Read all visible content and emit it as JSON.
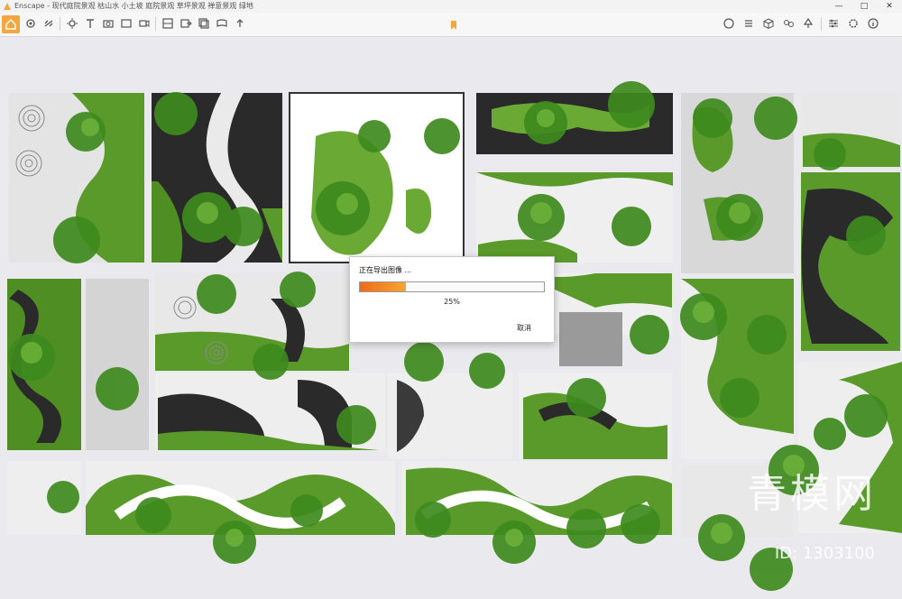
{
  "window": {
    "title": "Enscape - 现代庭院景观 枯山水 小土坡 庭院景观 草坪景观 禅意景观 绿地",
    "controls": [
      "—",
      "□",
      "✕"
    ]
  },
  "toolbar": {
    "icons": [
      "home-icon",
      "settings-icon",
      "link-icon",
      "sun-icon",
      "text-icon",
      "camera-icon",
      "frame-icon",
      "video-icon",
      "view-icon",
      "export-icon",
      "export-batch-icon",
      "panorama-icon",
      "upload-icon",
      "bookmark-icon",
      "material-icon",
      "list-icon",
      "cube-icon",
      "asset-icon",
      "tree-icon",
      "settings2-icon",
      "info-icon"
    ],
    "accent": "#f4a640"
  },
  "viewport": {
    "background": "#e9e9ee",
    "watermark_text": "青模网",
    "watermark_id": "ID: 1303100"
  },
  "dialog": {
    "title": "正在导出图像 ...",
    "progress_percent": 25,
    "progress_label": "25%",
    "cancel_label": "取消",
    "progress_colors": [
      "#f06a1a",
      "#f6a630"
    ]
  }
}
